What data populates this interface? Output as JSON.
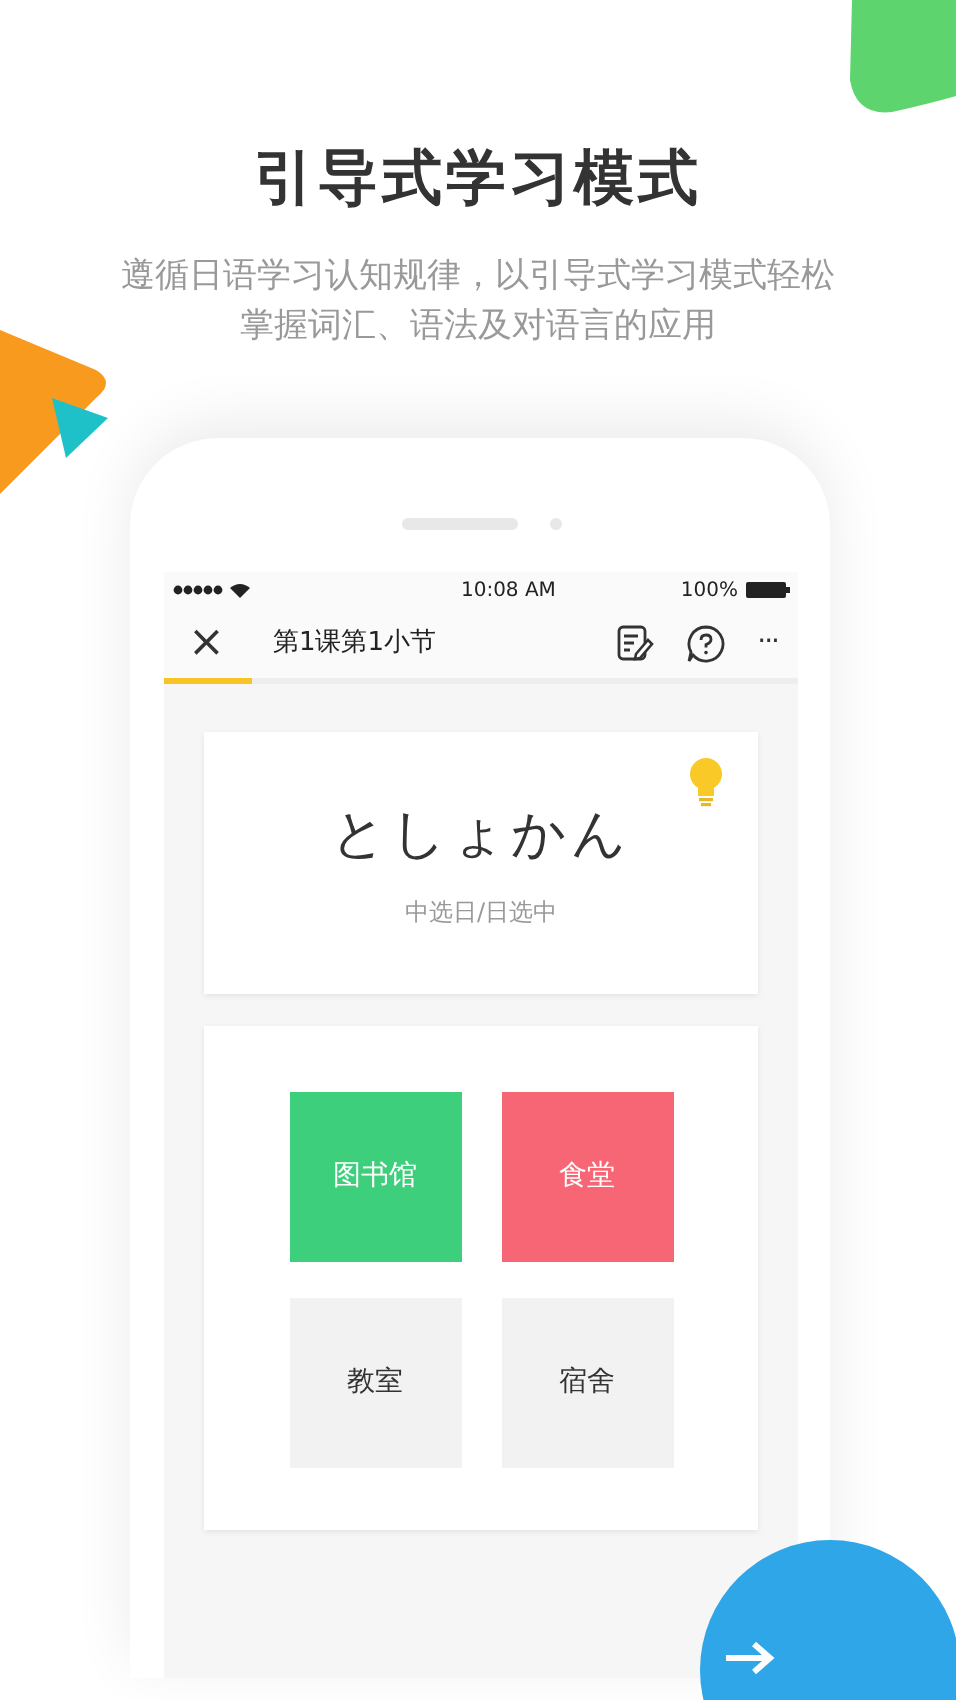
{
  "headline": "引导式学习模式",
  "subtitle": [
    "遵循日语学习认知规律，以引导式学习模式轻松",
    "掌握词汇、语法及对语言的应用"
  ],
  "status_bar": {
    "time": "10:08 AM",
    "battery": "100%"
  },
  "nav": {
    "close": "×",
    "title": "第1课第1小节",
    "more": "···"
  },
  "progress": {
    "level": 0.14
  },
  "question": {
    "word": "としょかん",
    "mode": "中选日/日选中"
  },
  "options": [
    {
      "label": "图书馆",
      "kind": "correct",
      "color": "#3ecf7c"
    },
    {
      "label": "食堂",
      "kind": "wrong",
      "color": "#f76674"
    },
    {
      "label": "教室",
      "kind": "plain",
      "color": "#f2f2f2"
    },
    {
      "label": "宿舍",
      "kind": "plain",
      "color": "#f2f2f2"
    }
  ]
}
